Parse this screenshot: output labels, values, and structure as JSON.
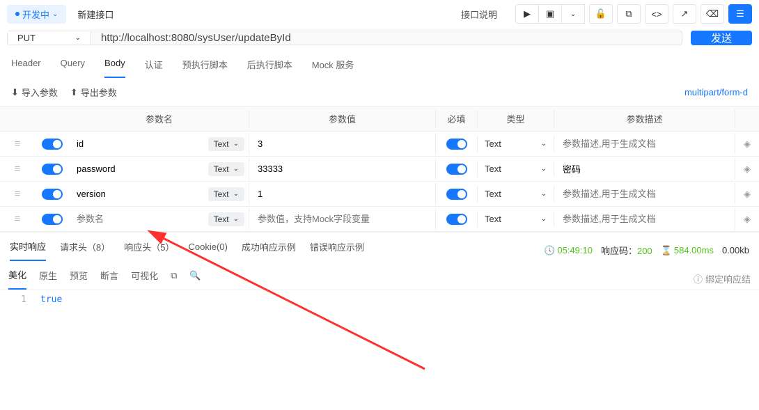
{
  "badge": "开发中",
  "apiName": "新建接口",
  "apiDesc": "接口说明",
  "method": "PUT",
  "url": "http://localhost:8080/sysUser/updateById",
  "sendBtn": "发送",
  "tabs": [
    "Header",
    "Query",
    "Body",
    "认证",
    "预执行脚本",
    "后执行脚本",
    "Mock 服务"
  ],
  "importParams": "导入参数",
  "exportParams": "导出参数",
  "bodyType": "multipart/form-d",
  "cols": {
    "name": "参数名",
    "value": "参数值",
    "required": "必填",
    "type": "类型",
    "desc": "参数描述"
  },
  "fieldType": "Text",
  "rows": [
    {
      "name": "id",
      "value": "3",
      "type": "Text",
      "desc": "",
      "descPh": "参数描述,用于生成文档"
    },
    {
      "name": "password",
      "value": "33333",
      "type": "Text",
      "desc": "密码",
      "descPh": "参数描述,用于生成文档"
    },
    {
      "name": "version",
      "value": "1",
      "type": "Text",
      "desc": "",
      "descPh": "参数描述,用于生成文档"
    }
  ],
  "namePh": "参数名",
  "valuePh": "参数值，支持Mock字段变量",
  "descPh": "参数描述,用于生成文档",
  "respTabs": {
    "live": "实时响应",
    "reqH": "请求头（8）",
    "respH": "响应头（5）",
    "cookie": "Cookie(0)",
    "success": "成功响应示例",
    "error": "错误响应示例"
  },
  "meta": {
    "time": "05:49:10",
    "statusLbl": "响应码：",
    "status": "200",
    "duration": "584.00ms",
    "size": "0.00kb"
  },
  "tools": [
    "美化",
    "原生",
    "预览",
    "断言",
    "可视化"
  ],
  "bindResp": "绑定响应结",
  "response": {
    "line": "1",
    "body": "true"
  }
}
